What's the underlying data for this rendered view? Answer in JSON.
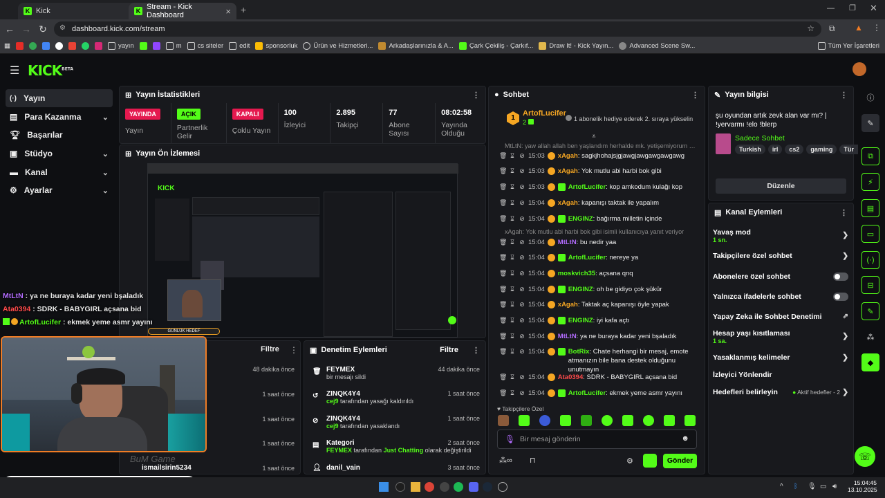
{
  "browser": {
    "tabs": [
      {
        "title": "Kick"
      },
      {
        "title": "Stream - Kick Dashboard"
      }
    ],
    "url": "dashboard.kick.com/stream",
    "bookmarks": [
      "yayın",
      "m",
      "cs siteler",
      "edit",
      "sponsorluk",
      "Ürün ve Hizmetleri...",
      "Arkadaşlarınızla & A...",
      "Çark Çekiliş - Çarkıf...",
      "Draw It! - Kick Yayın...",
      "Advanced Scene Sw..."
    ],
    "all_bookmarks": "Tüm Yer İşaretleri"
  },
  "kick": {
    "logo": "KICK",
    "beta": "BETA"
  },
  "sidebar": [
    {
      "label": "Yayın",
      "icon": "broadcast-icon",
      "active": true
    },
    {
      "label": "Para Kazanma",
      "icon": "money-icon",
      "chev": true
    },
    {
      "label": "Başarılar",
      "icon": "trophy-icon"
    },
    {
      "label": "Stüdyo",
      "icon": "studio-icon",
      "chev": true
    },
    {
      "label": "Kanal",
      "icon": "channel-icon",
      "chev": true
    },
    {
      "label": "Ayarlar",
      "icon": "settings-icon",
      "chev": true
    }
  ],
  "stats": {
    "title": "Yayın İstatistikleri",
    "items": [
      {
        "badge": "YAYINDA",
        "label": "Yayın",
        "color": "#e5194f"
      },
      {
        "badge": "AÇIK",
        "label": "Partnerlik Gelir",
        "color": "#53fc18"
      },
      {
        "badge": "KAPALI",
        "label": "Çoklu Yayın",
        "color": "#e5194f"
      },
      {
        "value": "100",
        "label": "İzleyici"
      },
      {
        "value": "2.895",
        "label": "Takipçi"
      },
      {
        "value": "77",
        "label": "Abone Sayısı"
      },
      {
        "value": "08:02:58",
        "label": "Yayında Olduğu"
      }
    ]
  },
  "preview": {
    "title": "Yayın Ön İzlemesi"
  },
  "chat": {
    "title": "Sohbet",
    "pinned_user": "ArtofLucifer",
    "pinned_count": "2",
    "pinned_text": "1 abonelik hediye ederek 2. sıraya yükselin",
    "system1": "MtLtN: yaw allah allah ben yaşlandım herhalde mk. yetişemiyorum bu ...",
    "system2": "xAgah: Yok mutlu abi harbi bok gibi isimli kullanıcıya yanıt veriyor",
    "messages": [
      {
        "time": "15:03",
        "user": "xAgah",
        "color": "#f5a623",
        "text": "sagkjhohajsjgjawgjawgawgawgawg"
      },
      {
        "time": "15:03",
        "user": "xAgah",
        "color": "#f5a623",
        "text": "Yok mutlu abi harbi bok gibi"
      },
      {
        "time": "15:03",
        "user": "ArtofLucifer",
        "color": "#53fc18",
        "text": "kop amkodum kulağı kop"
      },
      {
        "time": "15:04",
        "user": "xAgah",
        "color": "#f5a623",
        "text": "kapanışı taktak ile yapalım"
      },
      {
        "time": "15:04",
        "user": "ENGINZ",
        "color": "#53fc18",
        "text": "bağırma milletin içinde"
      },
      {
        "time": "15:04",
        "user": "MtLtN",
        "color": "#b36cff",
        "text": "bu nedir yaa"
      },
      {
        "time": "15:04",
        "user": "ArtofLucifer",
        "color": "#53fc18",
        "text": "nereye ya"
      },
      {
        "time": "15:04",
        "user": "moskvich35",
        "color": "#53fc18",
        "text": "açsana qnq"
      },
      {
        "time": "15:04",
        "user": "ENGINZ",
        "color": "#53fc18",
        "text": "oh be gidiyo çok şükür"
      },
      {
        "time": "15:04",
        "user": "xAgah",
        "color": "#f5a623",
        "text": "Taktak aç kapanışı öyle yapak"
      },
      {
        "time": "15:04",
        "user": "ENGINZ",
        "color": "#53fc18",
        "text": "iyi kafa açtı"
      },
      {
        "time": "15:04",
        "user": "MtLtN",
        "color": "#b36cff",
        "text": "ya ne buraya kadar yeni bşaladık"
      },
      {
        "time": "15:04",
        "user": "BotRix",
        "color": "#53fc18",
        "text": "Chate herhangi bir mesaj, emote atmanızın bile bana destek olduğunu unutmayın"
      },
      {
        "time": "15:04",
        "user": "Ata0394",
        "color": "#ff4b4b",
        "text": "SDRK - BABYGIRL açsana bid"
      },
      {
        "time": "15:04",
        "user": "ArtofLucifer",
        "color": "#53fc18",
        "text": "ekmek yeme asmr yayını"
      }
    ],
    "emote_label": "Takipçilere Özel",
    "input_placeholder": "Bir mesaj gönderin",
    "send": "Gönder"
  },
  "info": {
    "title": "Yayın bilgisi",
    "stream_title": "şu oyundan artık zevk alan var mı? | !yervarmı !elo !blerp",
    "category": "Sadece Sohbet",
    "tags": [
      "Turkish",
      "irl",
      "cs2",
      "gaming",
      "Tür"
    ],
    "edit": "Düzenle"
  },
  "channel_actions": {
    "title": "Kanal Eylemleri",
    "items": [
      {
        "label": "Yavaş mod",
        "sub": "1 sn.",
        "ctl": "chev"
      },
      {
        "label": "Takipçilere özel sohbet",
        "ctl": "chev"
      },
      {
        "label": "Abonelere özel sohbet",
        "ctl": "toggle"
      },
      {
        "label": "Yalnızca ifadelerle sohbet",
        "ctl": "toggle"
      },
      {
        "label": "Yapay Zeka ile Sohbet Denetimi",
        "ctl": "ext"
      },
      {
        "label": "Hesap yaşı kısıtlaması",
        "sub": "1 sa.",
        "ctl": "chev"
      },
      {
        "label": "Yasaklanmış kelimeler",
        "ctl": "chev"
      },
      {
        "label": "İzleyici Yönlendir"
      },
      {
        "label": "Hedefleri belirleyin",
        "extra": "Aktif hedefler - 2",
        "ctl": "chev"
      }
    ]
  },
  "activity": {
    "filter": "Filtre",
    "rows": [
      {
        "time": "48 dakika önce"
      },
      {
        "time": "1 saat önce"
      },
      {
        "time": "1 saat önce"
      },
      {
        "time": "1 saat önce"
      },
      {
        "time": "1 saat önce"
      }
    ],
    "partial": "ismailsirin5234"
  },
  "moderation": {
    "title": "Denetim Eylemleri",
    "filter": "Filtre",
    "rows": [
      {
        "user": "FEYMEX",
        "desc": "bir mesajı sildi",
        "time": "44 dakika önce"
      },
      {
        "user": "ZINQK4Y4",
        "desc_user": "cej9",
        "desc": "tarafından yasağı kaldırıldı",
        "time": "1 saat önce"
      },
      {
        "user": "ZINQK4Y4",
        "desc_user": "cej9",
        "desc": "tarafından yasaklandı",
        "time": "1 saat önce"
      },
      {
        "user": "Kategori",
        "desc_user": "FEYMEX",
        "desc": "tarafından",
        "desc_hl": "Just Chatting",
        "desc2": "olarak değiştirildi",
        "time": "2 saat önce"
      },
      {
        "user": "danil_vain",
        "time": "3 saat önce"
      }
    ]
  },
  "overlay": {
    "lines": [
      {
        "user": "MtLtN",
        "color": "#b36cff",
        "text": ": ya ne buraya kadar yeni bşaladık"
      },
      {
        "user": "Ata0394",
        "color": "#ff4b4b",
        "text": ": SDRK - BABYGIRL açsana bid"
      },
      {
        "user": "ArtofLucifer",
        "color": "#53fc18",
        "text": ": ekmek yeme asmr yayını"
      }
    ],
    "goal_count": "1",
    "goal_label": "GÜNLÜK HEDEF",
    "goal_target": "5",
    "goal_progress": 0.2
  },
  "taskbar": {
    "time": "15:04:45",
    "date": "13.10.2025"
  }
}
